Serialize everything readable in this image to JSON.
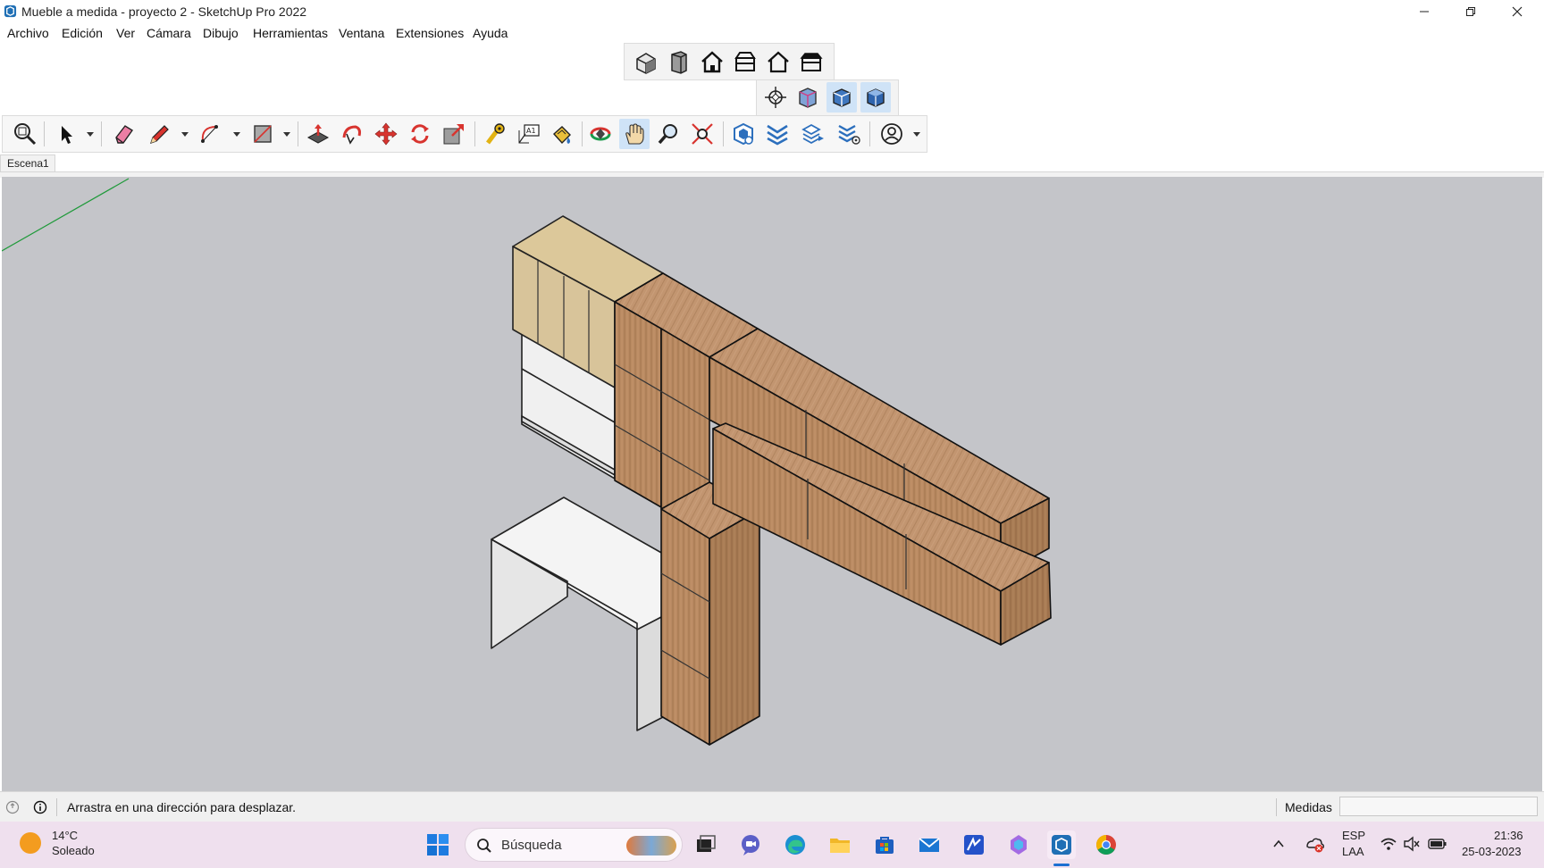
{
  "window": {
    "title": "Mueble a medida - proyecto 2 - SketchUp Pro 2022",
    "app_icon": "sketchup-logo-icon",
    "controls": [
      "minimize-icon",
      "restore-icon",
      "close-icon"
    ]
  },
  "menu": {
    "items": [
      "Archivo",
      "Edición",
      "Ver",
      "Cámara",
      "Dibujo",
      "Herramientas",
      "Ventana",
      "Extensiones",
      "Ayuda"
    ]
  },
  "toolbars": {
    "views": [
      "iso-view-icon",
      "top-view-icon",
      "front-view-icon",
      "right-view-icon",
      "back-view-icon",
      "left-view-icon"
    ],
    "styles": [
      "xray-icon",
      "back-edges-icon",
      "wireframe-icon",
      "shaded-icon"
    ],
    "main": [
      "zoom-window-icon",
      "select-icon",
      "eraser-icon",
      "pencil-icon",
      "arc-icon",
      "rectangle-icon",
      "push-pull-icon",
      "follow-me-icon",
      "move-icon",
      "rotate-icon",
      "scale-icon",
      "tape-measure-icon",
      "text-icon",
      "paint-bucket-icon",
      "orbit-icon",
      "pan-icon",
      "zoom-icon",
      "zoom-extents-icon",
      "components-icon",
      "sandbox-icon",
      "tags-icon",
      "outliner-icon",
      "account-icon"
    ],
    "active_tool": "pan-icon"
  },
  "scene": {
    "tab": "Escena1"
  },
  "statusbar": {
    "message": "Arrastra en una dirección para desplazar.",
    "measurements_label": "Medidas",
    "measurements_value": ""
  },
  "taskbar": {
    "weather": {
      "temp": "14°C",
      "condition": "Soleado"
    },
    "search_placeholder": "Búsqueda",
    "language": {
      "line1": "ESP",
      "line2": "LAA"
    },
    "time": "21:36",
    "date": "25-03-2023"
  },
  "colors": {
    "viewport_bg": "#c4c5c9",
    "wood": "#b98a62",
    "wood_light": "#dcc89a",
    "white_panel": "#eeeeee",
    "active_tool_bg": "#cfe3f7",
    "taskbar_bg": "#efe0ee"
  }
}
